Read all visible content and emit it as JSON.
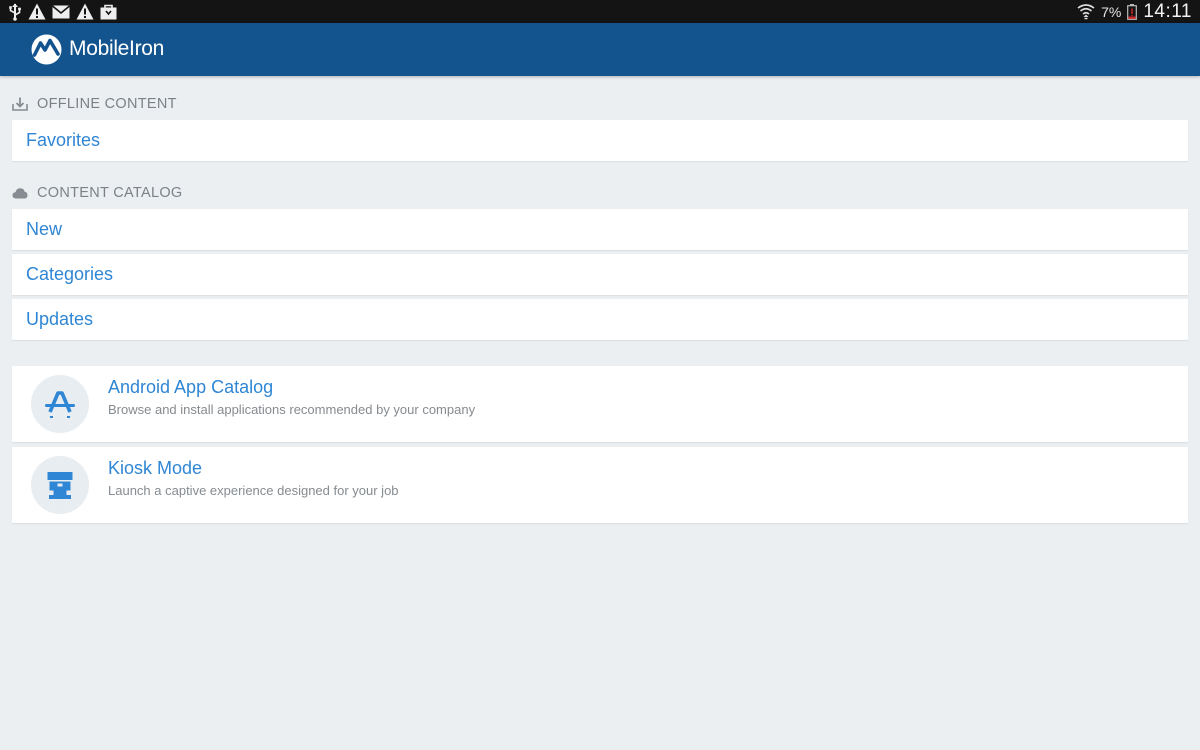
{
  "status_bar": {
    "battery_percent": "7%",
    "time": "14:11"
  },
  "app_bar": {
    "logo_text": "MobileIron"
  },
  "offline_section": {
    "header": "OFFLINE CONTENT",
    "items": [
      {
        "label": "Favorites"
      }
    ]
  },
  "catalog_section": {
    "header": "CONTENT CATALOG",
    "items": [
      {
        "label": "New"
      },
      {
        "label": "Categories"
      },
      {
        "label": "Updates"
      }
    ]
  },
  "apps": [
    {
      "title": "Android App Catalog",
      "description": "Browse and install applications recommended by your company",
      "icon": "app-store-a-icon"
    },
    {
      "title": "Kiosk Mode",
      "description": "Launch a captive experience designed for your job",
      "icon": "kiosk-icon"
    }
  ],
  "colors": {
    "app_bar": "#13548f",
    "accent_text": "#2f86d4",
    "background": "#ebeff2",
    "status_bar": "#141414"
  }
}
